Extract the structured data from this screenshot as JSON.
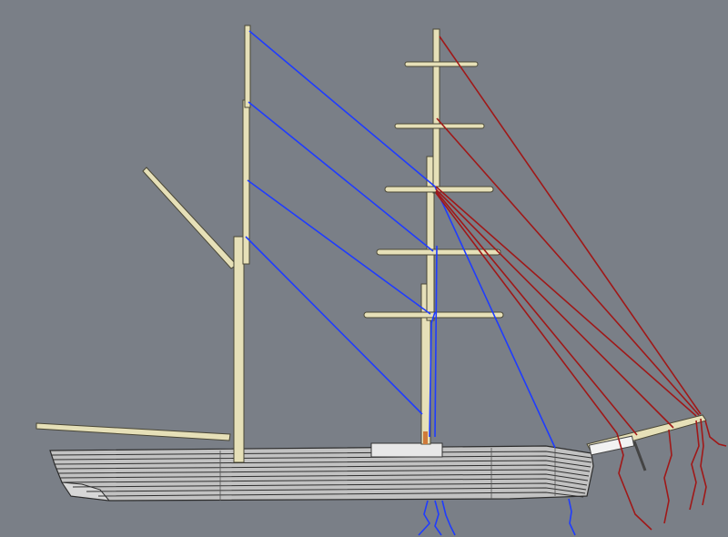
{
  "scene": {
    "background": "#7a7f87",
    "colors": {
      "spar_fill": "#e6e0b8",
      "spar_stroke": "#4a4736",
      "hull_fill": "#bdbdbd",
      "hull_dark": "#3a3a3a",
      "deckhouse": "#e6e6e6",
      "rigging_main": "#1f3cff",
      "rigging_fore": "#a01818"
    }
  }
}
